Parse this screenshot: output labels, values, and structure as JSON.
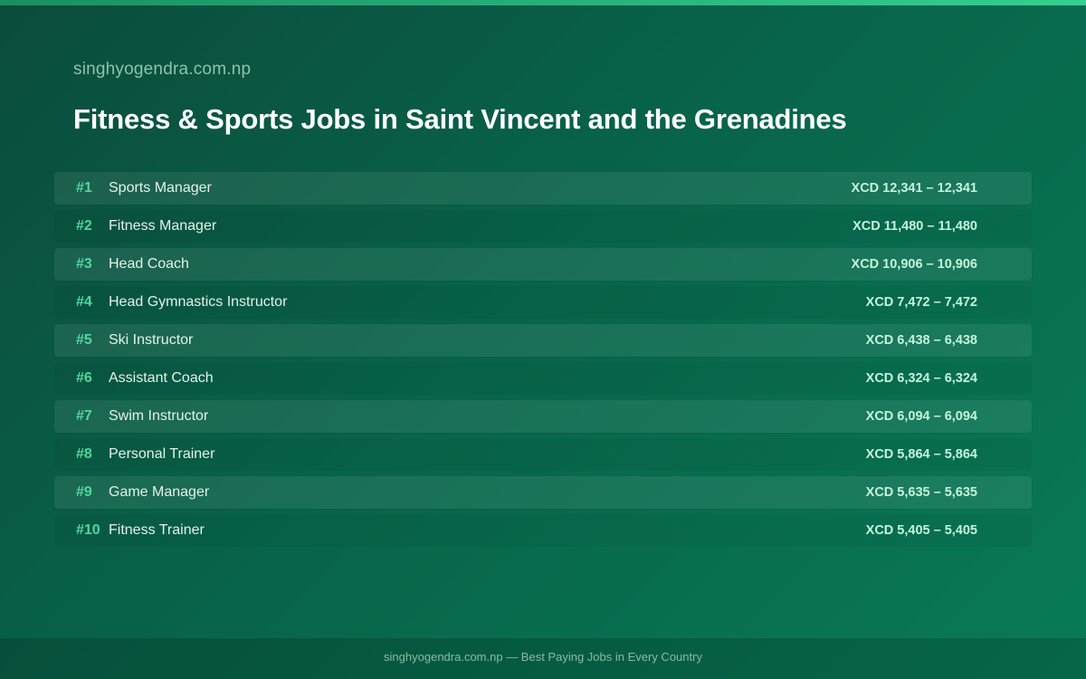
{
  "site": "singhyogendra.com.np",
  "title": "Fitness & Sports Jobs in Saint Vincent and the Grenadines",
  "jobs": [
    {
      "rank": "#1",
      "name": "Sports Manager",
      "salary": "XCD 12,341 – 12,341"
    },
    {
      "rank": "#2",
      "name": "Fitness Manager",
      "salary": "XCD 11,480 – 11,480"
    },
    {
      "rank": "#3",
      "name": "Head Coach",
      "salary": "XCD 10,906 – 10,906"
    },
    {
      "rank": "#4",
      "name": "Head Gymnastics Instructor",
      "salary": "XCD 7,472 – 7,472"
    },
    {
      "rank": "#5",
      "name": "Ski Instructor",
      "salary": "XCD 6,438 – 6,438"
    },
    {
      "rank": "#6",
      "name": "Assistant Coach",
      "salary": "XCD 6,324 – 6,324"
    },
    {
      "rank": "#7",
      "name": "Swim Instructor",
      "salary": "XCD 6,094 – 6,094"
    },
    {
      "rank": "#8",
      "name": "Personal Trainer",
      "salary": "XCD 5,864 – 5,864"
    },
    {
      "rank": "#9",
      "name": "Game Manager",
      "salary": "XCD 5,635 – 5,635"
    },
    {
      "rank": "#10",
      "name": "Fitness Trainer",
      "salary": "XCD 5,405 – 5,405"
    }
  ],
  "footer": "singhyogendra.com.np — Best Paying Jobs in Every Country",
  "colors": {
    "accent": "#52d79b",
    "background": "#08634a",
    "top_bar": "#35d08f"
  }
}
